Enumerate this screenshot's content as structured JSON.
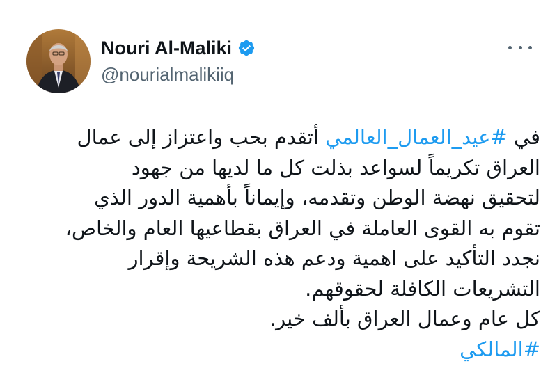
{
  "author": {
    "display_name": "Nouri Al-Maliki",
    "handle": "@nourialmalikiiq",
    "verified": true,
    "avatar_icon": "profile-photo"
  },
  "menu": {
    "more_icon": "more-horizontal-icon"
  },
  "colors": {
    "link": "#1d9bf0",
    "text": "#0f1419",
    "secondary": "#536471",
    "verified_badge": "#1d9bf0"
  },
  "tweet": {
    "line1_prefix": "في ",
    "line1_hashtag": "#عيد_العمال_العالمي",
    "line1_suffix": " أتقدم بحب واعتزاز إلى عمال",
    "line2": "العراق تكريماً لسواعد بذلت كل ما لديها من جهود",
    "line3": "لتحقيق نهضة الوطن وتقدمه، وإيماناً بأهمية الدور الذي",
    "line4": "تقوم به القوى العاملة في العراق بقطاعيها العام والخاص،",
    "line5": "نجدد التأكيد على اهمية ودعم هذه الشريحة وإقرار",
    "line6": "التشريعات الكافلة لحقوقهم.",
    "line7": "كل عام وعمال العراق بألف خير.",
    "line8_hashtag": "#المالكي"
  }
}
